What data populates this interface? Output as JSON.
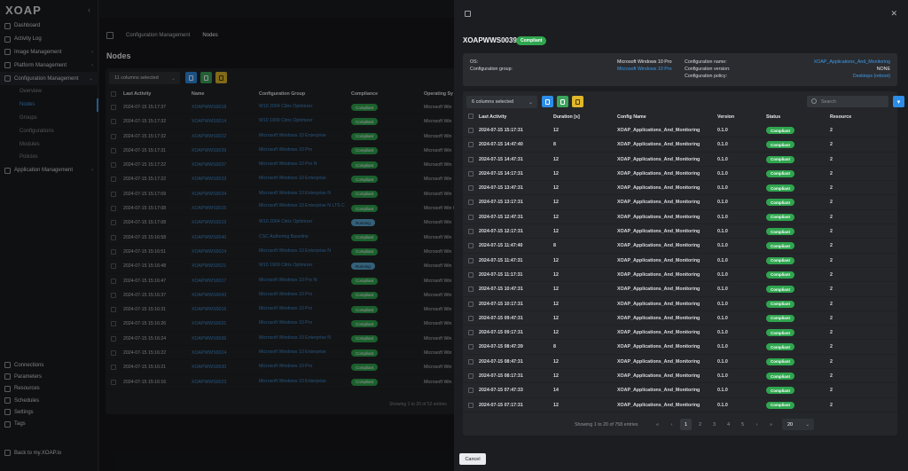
{
  "app": {
    "logo": "XOAP",
    "collapse_icon": "chevron-left-icon"
  },
  "sidebar": {
    "items": [
      {
        "label": "Dashboard",
        "icon": "dashboard-icon"
      },
      {
        "label": "Activity Log",
        "icon": "clock-icon"
      },
      {
        "label": "Image Management",
        "icon": "image-icon",
        "chevron": "›"
      },
      {
        "label": "Platform Management",
        "icon": "platform-icon",
        "chevron": "›"
      },
      {
        "label": "Configuration Management",
        "icon": "config-icon",
        "chevron": "⌄"
      },
      {
        "label": "Overview"
      },
      {
        "label": "Nodes"
      },
      {
        "label": "Groups"
      },
      {
        "label": "Configurations"
      },
      {
        "label": "Modules"
      },
      {
        "label": "Policies"
      },
      {
        "label": "Application Management",
        "icon": "app-icon",
        "chevron": "›"
      }
    ],
    "bottom": [
      {
        "label": "Connections"
      },
      {
        "label": "Parameters"
      },
      {
        "label": "Resources"
      },
      {
        "label": "Schedules"
      },
      {
        "label": "Settings"
      },
      {
        "label": "Tags"
      }
    ],
    "back": "Back to my.XOAP.io"
  },
  "breadcrumb": {
    "items": [
      "Configuration Management",
      "Nodes"
    ]
  },
  "page": {
    "title": "Nodes",
    "columns_selected": "11 columns selected",
    "headers": {
      "last_activity": "Last Activity",
      "name": "Name",
      "group": "Configuration Group",
      "compliance": "Compliance",
      "os": "Operating Sy"
    },
    "rows": [
      {
        "t": "2024-07-15 15:17:37",
        "n": "XOAPWWS0018",
        "g": "W10 2004 Citrix Optimizer",
        "s": "Compliant",
        "o": "Microsoft Win"
      },
      {
        "t": "2024-07-15 15:17:32",
        "n": "XOAPWWS0014",
        "g": "W10 1909 Citrix Optimizer",
        "s": "Compliant",
        "o": "Microsoft Win"
      },
      {
        "t": "2024-07-15 15:17:32",
        "n": "XOAPWWS0022",
        "g": "Microsoft Windows 10 Enterprise",
        "s": "Compliant",
        "o": "Microsoft Win"
      },
      {
        "t": "2024-07-15 15:17:31",
        "n": "XOAPWWS0039",
        "g": "Microsoft Windows 10 Pro",
        "s": "Compliant",
        "o": "Microsoft Win"
      },
      {
        "t": "2024-07-15 15:17:22",
        "n": "XOAPWWS0037",
        "g": "Microsoft Windows 10 Pro N",
        "s": "Compliant",
        "o": "Microsoft Win"
      },
      {
        "t": "2024-07-15 15:17:22",
        "n": "XOAPWWS0033",
        "g": "Microsoft Windows 10 Enterprise",
        "s": "Compliant",
        "o": "Microsoft Win"
      },
      {
        "t": "2024-07-15 15:17:09",
        "n": "XOAPWWS0034",
        "g": "Microsoft Windows 10 Enterprise N",
        "s": "Compliant",
        "o": "Microsoft Win"
      },
      {
        "t": "2024-07-15 15:17:08",
        "n": "XOAPWWS0015",
        "g": "Microsoft Windows 10 Enterprise N LTS C",
        "s": "Compliant",
        "o": "Microsoft Win C"
      },
      {
        "t": "2024-07-15 15:17:08",
        "n": "XOAPWWS0019",
        "g": "W10 2004 Citrix Optimizer",
        "s": "Running",
        "o": "Microsoft Win"
      },
      {
        "t": "2024-07-15 15:16:58",
        "n": "XOAPWWS0040",
        "g": "CSC Authoring Baseline",
        "s": "Compliant",
        "o": "Microsoft Win"
      },
      {
        "t": "2024-07-15 15:16:51",
        "n": "XOAPWWS0024",
        "g": "Microsoft Windows 10 Enterprise N",
        "s": "Compliant",
        "o": "Microsoft Win"
      },
      {
        "t": "2024-07-15 15:16:48",
        "n": "XOAPWWS0021",
        "g": "W10 1909 Citrix Optimizer",
        "s": "Running",
        "o": "Microsoft Win"
      },
      {
        "t": "2024-07-15 15:16:47",
        "n": "XOAPWWS0017",
        "g": "Microsoft Windows 10 Pro N",
        "s": "Compliant",
        "o": "Microsoft Win"
      },
      {
        "t": "2024-07-15 15:16:37",
        "n": "XOAPWWS0043",
        "g": "Microsoft Windows 10 Pro",
        "s": "Compliant",
        "o": "Microsoft Win"
      },
      {
        "t": "2024-07-15 15:16:31",
        "n": "XOAPWWS0016",
        "g": "Microsoft Windows 10 Pro",
        "s": "Compliant",
        "o": "Microsoft Win"
      },
      {
        "t": "2024-07-15 15:16:26",
        "n": "XOAPWWS0031",
        "g": "Microsoft Windows 10 Pro",
        "s": "Compliant",
        "o": "Microsoft Win"
      },
      {
        "t": "2024-07-15 15:16:24",
        "n": "XOAPWWS0036",
        "g": "Microsoft Windows 10 Enterprise N",
        "s": "Compliant",
        "o": "Microsoft Win"
      },
      {
        "t": "2024-07-15 15:16:22",
        "n": "XOAPWWS0024",
        "g": "Microsoft Windows 10 Enterprise",
        "s": "Compliant",
        "o": "Microsoft Win"
      },
      {
        "t": "2024-07-15 15:16:21",
        "n": "XOAPWWS0030",
        "g": "Microsoft Windows 10 Pro",
        "s": "Compliant",
        "o": "Microsoft Win"
      },
      {
        "t": "2024-07-15 15:16:16",
        "n": "XOAPWWS0023",
        "g": "Microsoft Windows 10 Enterprise",
        "s": "Compliant",
        "o": "Microsoft Win"
      }
    ],
    "footer": "Showing 1 to 20 of 52 entries"
  },
  "modal": {
    "title": "XOAPWWS0039",
    "badge": "Compliant",
    "info": {
      "os_label": "OS:",
      "os_value": "Microsoft Windows 10 Pro",
      "group_label": "Configuration group:",
      "group_value": "Microsoft Windows 10 Pro",
      "cfg_name_label": "Configuration name:",
      "cfg_name_value": "XOAP_Applications_And_Monitoring",
      "cfg_version_label": "Configuration version:",
      "cfg_version_value": "NONE",
      "cfg_policy_label": "Configuration policy:",
      "cfg_policy_value": "Desktops (reboot)"
    },
    "columns_selected": "6 columns selected",
    "search_placeholder": "Search",
    "headers": {
      "last_activity": "Last Activity",
      "duration": "Duration [s]",
      "config": "Config Name",
      "version": "Version",
      "status": "Status",
      "resource": "Resource"
    },
    "rows": [
      {
        "t": "2024-07-15 15:17:31",
        "d": "12",
        "c": "XOAP_Applications_And_Monitoring",
        "v": "0.1.0",
        "s": "Compliant",
        "r": "2"
      },
      {
        "t": "2024-07-15 14:47:40",
        "d": "8",
        "c": "XOAP_Applications_And_Monitoring",
        "v": "0.1.0",
        "s": "Compliant",
        "r": "2"
      },
      {
        "t": "2024-07-15 14:47:31",
        "d": "12",
        "c": "XOAP_Applications_And_Monitoring",
        "v": "0.1.0",
        "s": "Compliant",
        "r": "2"
      },
      {
        "t": "2024-07-15 14:17:31",
        "d": "12",
        "c": "XOAP_Applications_And_Monitoring",
        "v": "0.1.0",
        "s": "Compliant",
        "r": "2"
      },
      {
        "t": "2024-07-15 13:47:31",
        "d": "12",
        "c": "XOAP_Applications_And_Monitoring",
        "v": "0.1.0",
        "s": "Compliant",
        "r": "2"
      },
      {
        "t": "2024-07-15 13:17:31",
        "d": "12",
        "c": "XOAP_Applications_And_Monitoring",
        "v": "0.1.0",
        "s": "Compliant",
        "r": "2"
      },
      {
        "t": "2024-07-15 12:47:31",
        "d": "12",
        "c": "XOAP_Applications_And_Monitoring",
        "v": "0.1.0",
        "s": "Compliant",
        "r": "2"
      },
      {
        "t": "2024-07-15 12:17:31",
        "d": "12",
        "c": "XOAP_Applications_And_Monitoring",
        "v": "0.1.0",
        "s": "Compliant",
        "r": "2"
      },
      {
        "t": "2024-07-15 11:47:40",
        "d": "8",
        "c": "XOAP_Applications_And_Monitoring",
        "v": "0.1.0",
        "s": "Compliant",
        "r": "2"
      },
      {
        "t": "2024-07-15 11:47:31",
        "d": "12",
        "c": "XOAP_Applications_And_Monitoring",
        "v": "0.1.0",
        "s": "Compliant",
        "r": "2"
      },
      {
        "t": "2024-07-15 11:17:31",
        "d": "12",
        "c": "XOAP_Applications_And_Monitoring",
        "v": "0.1.0",
        "s": "Compliant",
        "r": "2"
      },
      {
        "t": "2024-07-15 10:47:31",
        "d": "12",
        "c": "XOAP_Applications_And_Monitoring",
        "v": "0.1.0",
        "s": "Compliant",
        "r": "2"
      },
      {
        "t": "2024-07-15 10:17:31",
        "d": "12",
        "c": "XOAP_Applications_And_Monitoring",
        "v": "0.1.0",
        "s": "Compliant",
        "r": "2"
      },
      {
        "t": "2024-07-15 09:47:31",
        "d": "12",
        "c": "XOAP_Applications_And_Monitoring",
        "v": "0.1.0",
        "s": "Compliant",
        "r": "2"
      },
      {
        "t": "2024-07-15 09:17:31",
        "d": "12",
        "c": "XOAP_Applications_And_Monitoring",
        "v": "0.1.0",
        "s": "Compliant",
        "r": "2"
      },
      {
        "t": "2024-07-15 08:47:39",
        "d": "8",
        "c": "XOAP_Applications_And_Monitoring",
        "v": "0.1.0",
        "s": "Compliant",
        "r": "2"
      },
      {
        "t": "2024-07-15 08:47:31",
        "d": "12",
        "c": "XOAP_Applications_And_Monitoring",
        "v": "0.1.0",
        "s": "Compliant",
        "r": "2"
      },
      {
        "t": "2024-07-15 08:17:31",
        "d": "12",
        "c": "XOAP_Applications_And_Monitoring",
        "v": "0.1.0",
        "s": "Compliant",
        "r": "2"
      },
      {
        "t": "2024-07-15 07:47:33",
        "d": "14",
        "c": "XOAP_Applications_And_Monitoring",
        "v": "0.1.0",
        "s": "Compliant",
        "r": "2"
      },
      {
        "t": "2024-07-15 07:17:31",
        "d": "12",
        "c": "XOAP_Applications_And_Monitoring",
        "v": "0.1.0",
        "s": "Compliant",
        "r": "2"
      }
    ],
    "footer": {
      "entries": "Showing 1 to 20 of 758 entries",
      "first": "«",
      "prev": "‹",
      "pages": [
        "1",
        "2",
        "3",
        "4",
        "5"
      ],
      "next": "›",
      "last": "»",
      "page_size": "20"
    },
    "cancel": "Cancel"
  },
  "colors": {
    "accent": "#2d8ce6",
    "compliant": "#2fa64f",
    "running": "#5aa6d1",
    "link": "#3d9be9"
  }
}
